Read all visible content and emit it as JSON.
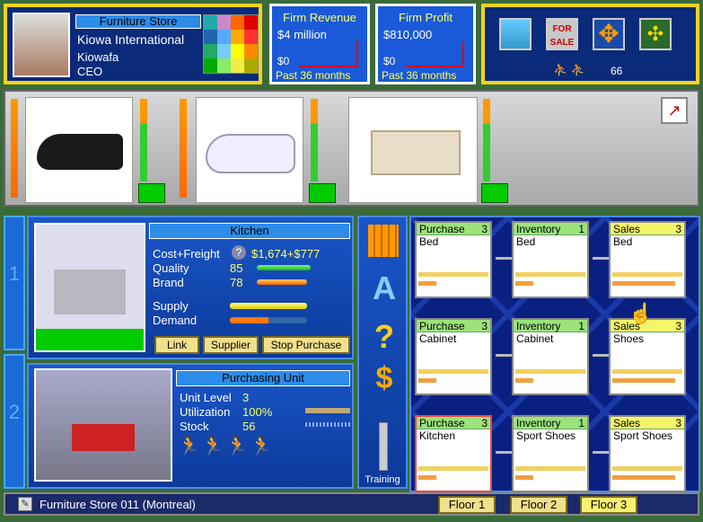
{
  "header": {
    "store_type": "Furniture Store",
    "company": "Kiowa International",
    "person": "Kiowafa",
    "role": "CEO",
    "revenue": {
      "title": "Firm Revenue",
      "value": "$4 million",
      "axis_zero": "$0",
      "period": "Past 36 months"
    },
    "profit": {
      "title": "Firm Profit",
      "value": "$810,000",
      "axis_zero": "$0",
      "period": "Past 36 months"
    },
    "sale_sign": "FOR SALE",
    "population": "66"
  },
  "products": [
    {
      "name": "shoe-leather"
    },
    {
      "name": "sneaker"
    },
    {
      "name": "bed"
    }
  ],
  "unit1": {
    "title": "Kitchen",
    "cost_label": "Cost+Freight",
    "cost_value": "$1,674+$777",
    "quality_label": "Quality",
    "quality_value": "85",
    "quality_level": 0.85,
    "brand_label": "Brand",
    "brand_value": "78",
    "brand_level": 0.78,
    "supply_label": "Supply",
    "demand_label": "Demand",
    "buttons": [
      "Link",
      "Supplier",
      "Stop Purchase"
    ]
  },
  "unit2": {
    "title": "Purchasing Unit",
    "level_label": "Unit Level",
    "level_value": "3",
    "util_label": "Utilization",
    "util_value": "100%",
    "stock_label": "Stock",
    "stock_value": "56"
  },
  "side": {
    "training": "Training"
  },
  "grid": [
    {
      "type": "Purchase",
      "lvl": "3",
      "item": "Bed",
      "hd": "#9be37a"
    },
    {
      "type": "Inventory",
      "lvl": "1",
      "item": "Bed",
      "hd": "#9be37a"
    },
    {
      "type": "Sales",
      "lvl": "3",
      "item": "Bed",
      "hd": "#f5f56a"
    },
    {
      "type": "Purchase",
      "lvl": "3",
      "item": "Cabinet",
      "hd": "#9be37a"
    },
    {
      "type": "Inventory",
      "lvl": "1",
      "item": "Cabinet",
      "hd": "#9be37a"
    },
    {
      "type": "Sales",
      "lvl": "3",
      "item": "Shoes",
      "hd": "#f5f56a"
    },
    {
      "type": "Purchase",
      "lvl": "3",
      "item": "Kitchen",
      "hd": "#9be37a"
    },
    {
      "type": "Inventory",
      "lvl": "1",
      "item": "Sport Shoes",
      "hd": "#9be37a"
    },
    {
      "type": "Sales",
      "lvl": "3",
      "item": "Sport Shoes",
      "hd": "#f5f56a"
    }
  ],
  "footer": {
    "status": "Furniture Store 011 (Montreal)",
    "floors": [
      "Floor 1",
      "Floor 2",
      "Floor 3"
    ]
  },
  "side_tabs": [
    "1",
    "2"
  ]
}
